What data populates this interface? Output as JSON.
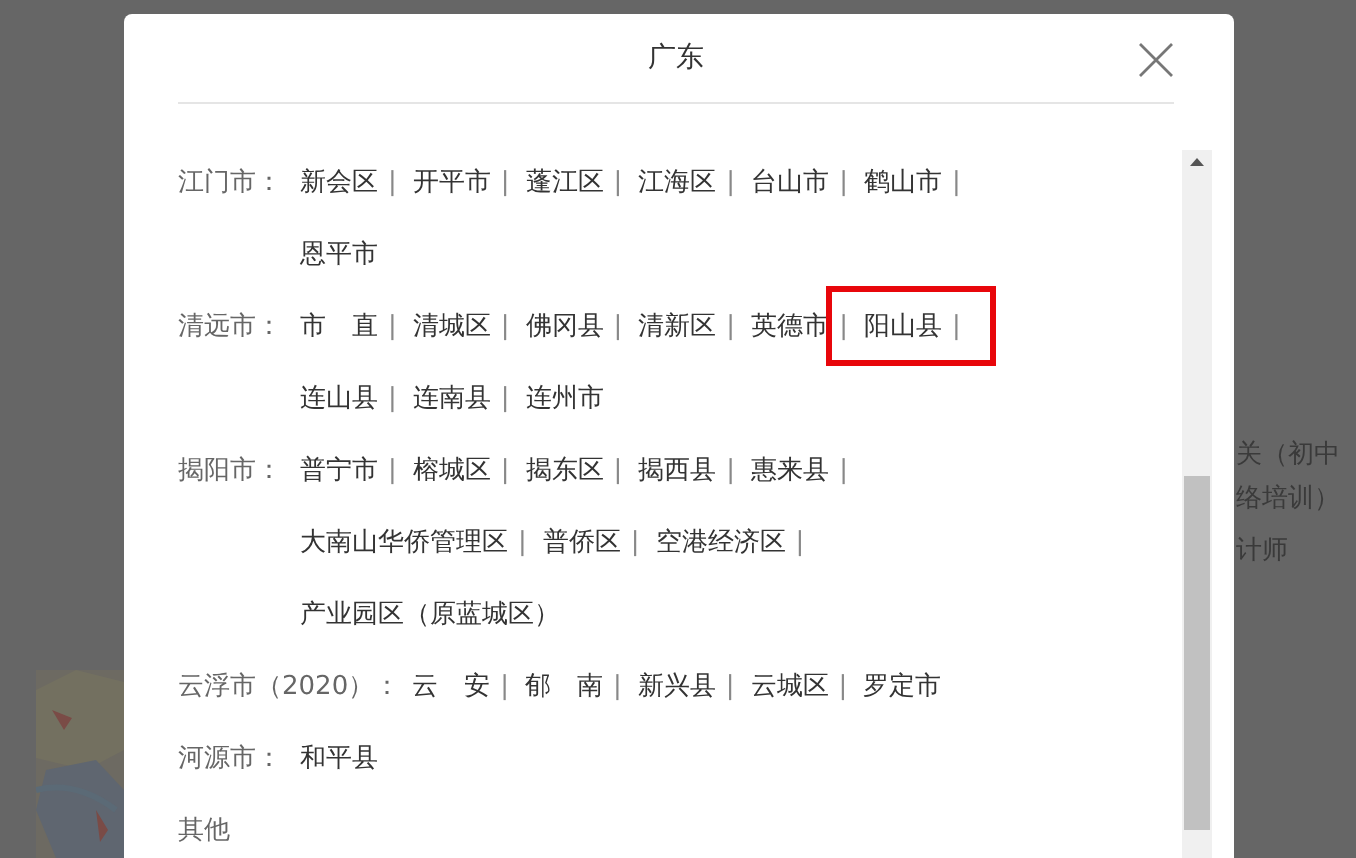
{
  "background": {
    "texts": [
      "关（初中",
      "络培训）",
      "计师"
    ]
  },
  "dialog": {
    "title": "广东",
    "groups": [
      {
        "label": "江门市：",
        "items": [
          {
            "name": "新会区",
            "sep": "|"
          },
          {
            "name": "开平市",
            "sep": "|"
          },
          {
            "name": "蓬江区",
            "sep": "|"
          },
          {
            "name": "江海区",
            "sep": "|"
          },
          {
            "name": "台山市",
            "sep": "|"
          },
          {
            "name": "鹤山市",
            "sep": "|"
          },
          {
            "name": "恩平市"
          }
        ]
      },
      {
        "label": "清远市：",
        "items": [
          {
            "name": "市　直",
            "sep": "|"
          },
          {
            "name": "清城区",
            "sep": "|"
          },
          {
            "name": "佛冈县",
            "sep": "|"
          },
          {
            "name": "清新区",
            "sep": "|"
          },
          {
            "name": "英德市",
            "sep": "|"
          },
          {
            "name": "阳山县",
            "sep": "|",
            "highlighted": true
          },
          {
            "name": "连山县",
            "sep": "|"
          },
          {
            "name": "连南县",
            "sep": "|"
          },
          {
            "name": "连州市"
          }
        ]
      },
      {
        "label": "揭阳市：",
        "items": [
          {
            "name": "普宁市",
            "sep": "|"
          },
          {
            "name": "榕城区",
            "sep": "|"
          },
          {
            "name": "揭东区",
            "sep": "|"
          },
          {
            "name": "揭西县",
            "sep": "|"
          },
          {
            "name": "惠来县",
            "sep": "|"
          },
          {
            "name": "大南山华侨管理区",
            "sep": "|"
          },
          {
            "name": "普侨区",
            "sep": "|"
          },
          {
            "name": "空港经济区",
            "sep": "|"
          },
          {
            "name": "产业园区（原蓝城区）"
          }
        ]
      },
      {
        "label": "云浮市（2020）：",
        "items": [
          {
            "name": "云　安",
            "sep": "|"
          },
          {
            "name": "郁　南",
            "sep": "|"
          },
          {
            "name": "新兴县",
            "sep": "|"
          },
          {
            "name": "云城区",
            "sep": "|"
          },
          {
            "name": "罗定市"
          }
        ]
      },
      {
        "label": "河源市：",
        "items": [
          {
            "name": "和平县"
          }
        ]
      },
      {
        "label": "其他"
      }
    ]
  }
}
